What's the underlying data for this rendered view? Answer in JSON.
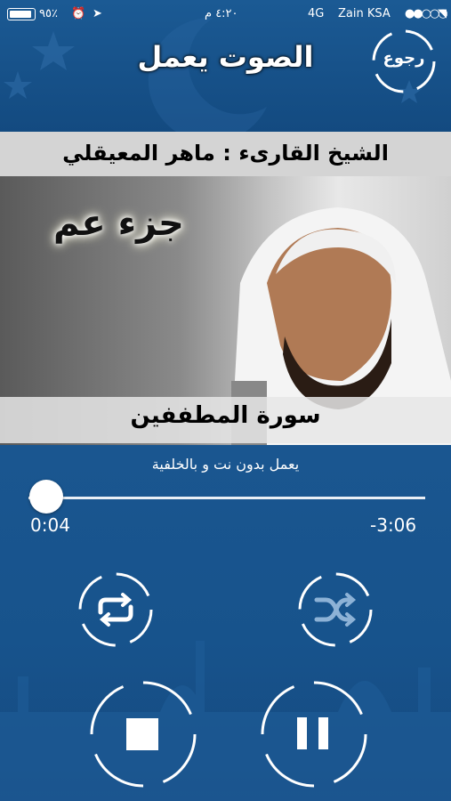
{
  "status": {
    "carrier": "Zain KSA",
    "network": "4G",
    "time": "٤:٢٠ م",
    "battery": "٩٥٪"
  },
  "header": {
    "title": "الصوت يعمل",
    "back_label": "رجوع"
  },
  "banner": {
    "reciter": "الشيخ القارىء : ماهر المعيقلي"
  },
  "artwork": {
    "juz": "جزء عم",
    "surah": "سورة المطففين"
  },
  "player": {
    "subtitle": "يعمل بدون نت و بالخلفية",
    "elapsed": "0:04",
    "remaining": "-3:06"
  },
  "icons": [
    "repeat-icon",
    "shuffle-icon",
    "stop-icon",
    "pause-icon"
  ]
}
